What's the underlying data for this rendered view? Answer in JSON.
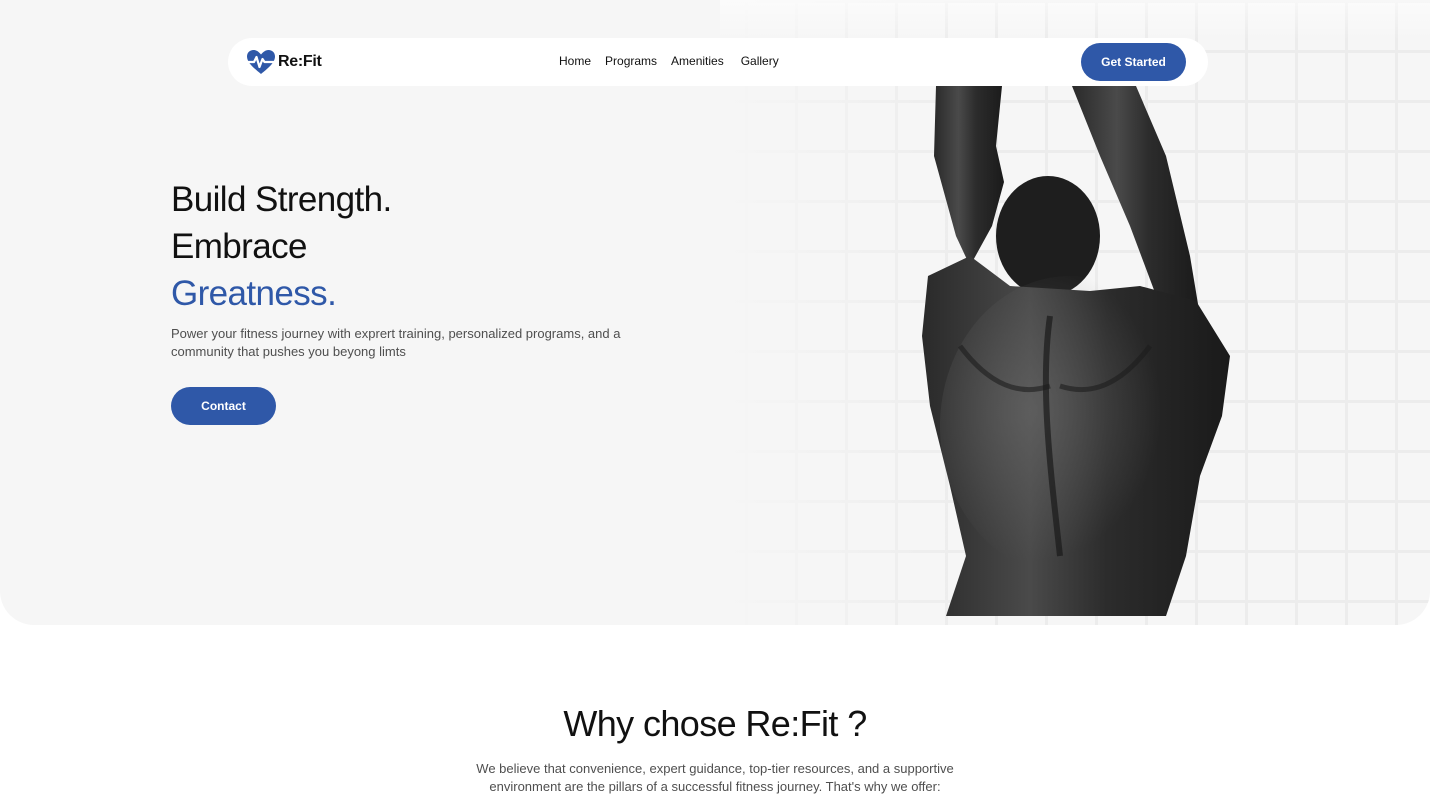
{
  "brand": {
    "name": "Re:Fit",
    "accent_color": "#2f58a8",
    "logo_icon": "heart-pulse-icon"
  },
  "nav": {
    "links": [
      "Home",
      "Programs",
      "Amenities",
      "Gallery"
    ],
    "cta_label": "Get Started"
  },
  "hero": {
    "headline_line1": "Build Strength.",
    "headline_line2": "Embrace",
    "headline_line3": "Greatness.",
    "subtitle": "Power your fitness journey with exprert training, personalized programs, and a community that pushes you beyong limts",
    "button_label": "Contact",
    "image": "athlete-back-photo"
  },
  "why": {
    "title": "Why chose Re:Fit ?",
    "description": "We believe that convenience, expert guidance, top-tier resources, and a supportive environment are the pillars of a successful fitness journey. That's why we offer:"
  }
}
